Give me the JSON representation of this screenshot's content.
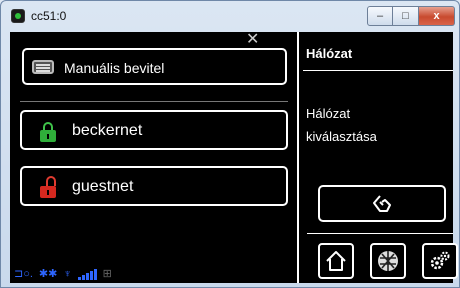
{
  "window": {
    "title": "cc51:0"
  },
  "titlebar": {
    "minimize": "–",
    "maximize": "□",
    "close": "x"
  },
  "left": {
    "manual_entry_label": "Manuális bevitel",
    "networks": [
      {
        "name": "beckernet",
        "lock_color": "#2fae3a"
      },
      {
        "name": "guestnet",
        "lock_color": "#d4281f"
      }
    ]
  },
  "right": {
    "title": "Hálózat",
    "desc_line1": "Hálózat",
    "desc_line2": "kiválasztása"
  },
  "icons": {
    "back": "back-hand-icon",
    "home": "home-icon",
    "globe": "globe-icon",
    "settings": "gears-icon"
  },
  "colors": {
    "status_blue": "#2e66ff",
    "background": "#000000",
    "foreground": "#ffffff"
  }
}
